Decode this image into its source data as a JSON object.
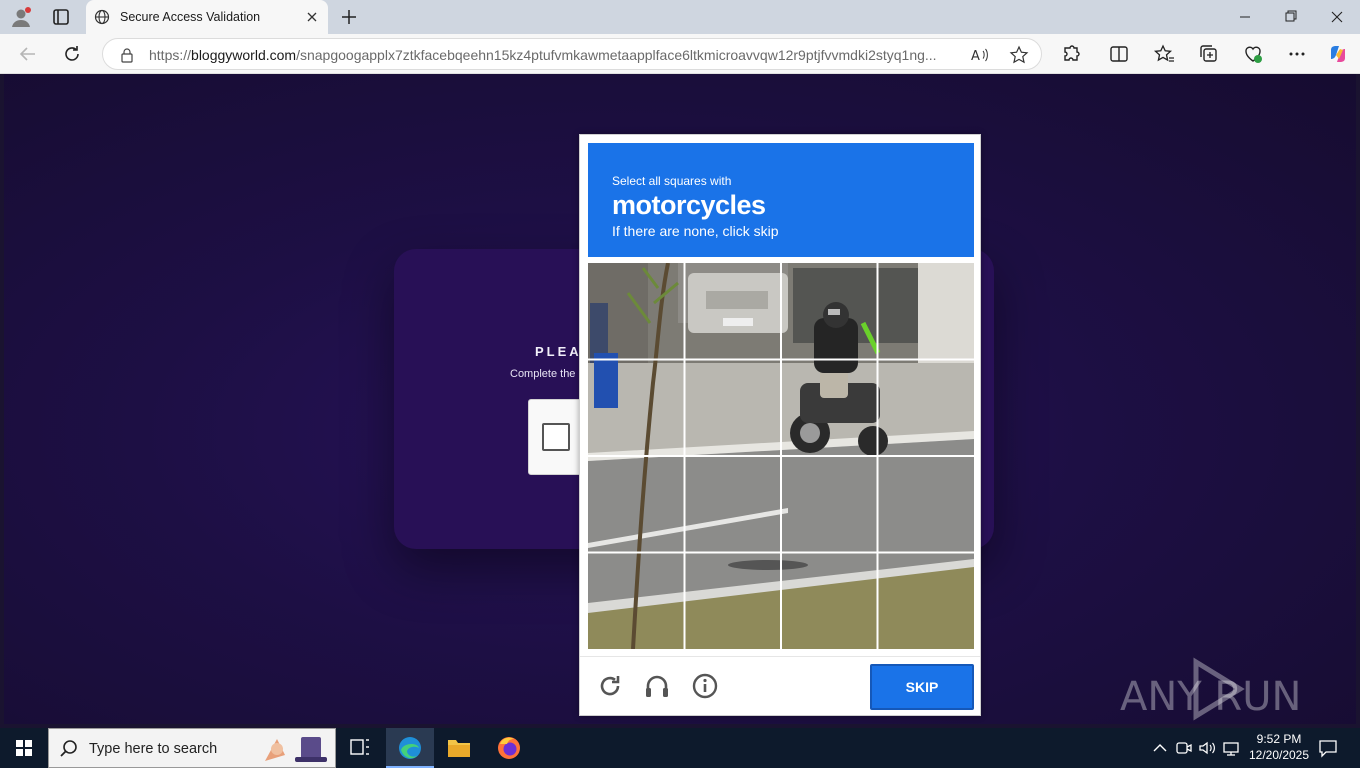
{
  "browser": {
    "tab_title": "Secure Access Validation",
    "url_prefix": "https://",
    "url_host": "bloggyworld.com",
    "url_path": "/snapgoogapplx7ztkfacebqeehn15kz4ptufvmkawmetaapplface6ltkmicroavvqw12r9ptjfvvmdki2styq1ng..."
  },
  "page": {
    "heading": "PLEAS",
    "subtext": "Complete the",
    "watermark_text": "ANY RUN"
  },
  "captcha": {
    "instruction": "Select all squares with",
    "target": "motorcycles",
    "hint": "If there are none, click skip",
    "skip_label": "SKIP",
    "grid_size": 4
  },
  "taskbar": {
    "search_placeholder": "Type here to search",
    "time": "9:52 PM",
    "date": "12/20/2025"
  },
  "colors": {
    "captcha_blue": "#1a73e8",
    "page_bg": "#1d0f44",
    "card_bg": "#281056"
  }
}
